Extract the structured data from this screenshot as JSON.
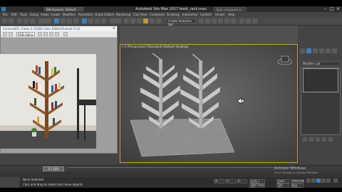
{
  "window": {
    "title": "Autodesk 3ds Max 2017    book_rack.max",
    "workspace": "Workspaces: Default",
    "search_placeholder": "Type a keyword or phrase",
    "minimize": "–",
    "maximize": "□",
    "close": "×"
  },
  "menu": {
    "items": [
      "File",
      "Edit",
      "Tools",
      "Group",
      "Views",
      "Create",
      "Modifiers",
      "Animation",
      "Graph Editors",
      "Rendering",
      "Civil View",
      "Customize",
      "Scripting",
      "Interactive",
      "Content",
      "Arnold",
      "Help"
    ]
  },
  "toolbar": {
    "selection_set": "Create Selection Set"
  },
  "frame_window": {
    "title": "Camera001, frame 0, RGBA Color 8 Bits/Channel (1:2)",
    "channel": "RGB Alpha",
    "close": "×"
  },
  "viewport": {
    "label": "[+] [Perspective] [Standard] [Default Shading]"
  },
  "command_panel": {
    "modifier_list": "Modifier List"
  },
  "timeline": {
    "frame_readout": "0 / 100"
  },
  "status": {
    "selection": "None Selected",
    "prompt": "Click and drag to select and move objects",
    "x_label": "X:",
    "y_label": "Y:",
    "z_label": "Z:",
    "grid": "Grid = 10.0",
    "add_time_tag": "Add Time Tag",
    "auto_key": "Auto Key",
    "set_key": "Set Key",
    "selected": "Selected",
    "key_filters": "Key Filters..."
  },
  "watermark": {
    "line1": "Activate Windows",
    "line2": "Go to Settings to activate Windows."
  },
  "colors": {
    "viewport_border": "#c9a030",
    "active_button": "#3f7fb8",
    "viewport_bg": "#5a5a5a"
  }
}
